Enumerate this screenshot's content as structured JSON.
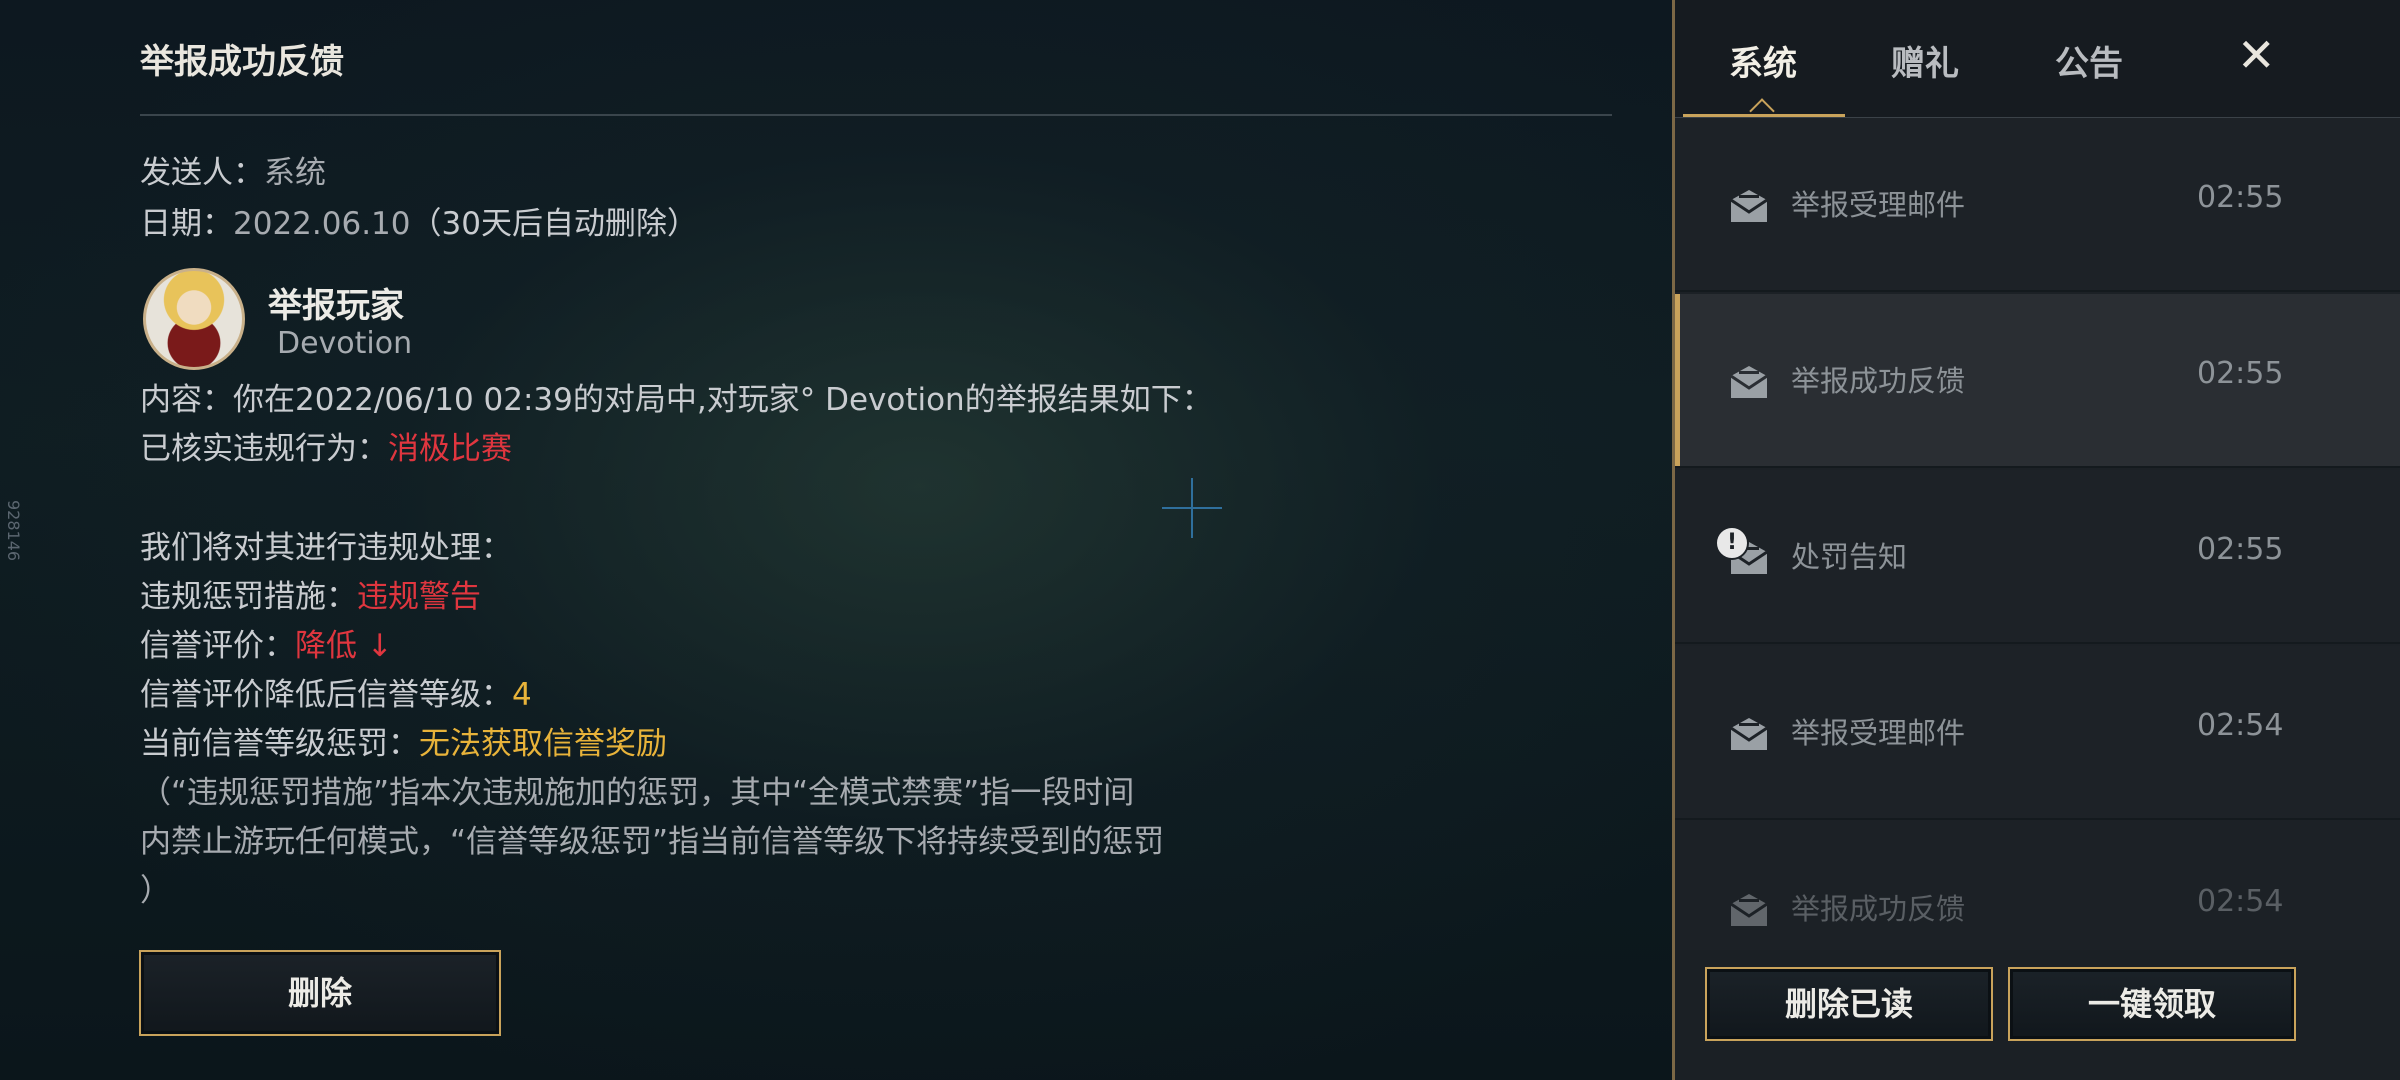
{
  "mail_detail": {
    "title": "举报成功反馈",
    "sender_label": "发送人：",
    "sender_value": "系统",
    "date_label": "日期：",
    "date_value": "2022.06.10",
    "auto_delete_note": "（30天后自动删除）",
    "reported_player_heading": "举报玩家",
    "reported_player_name": "Devotion",
    "content_line": "内容：你在2022/06/10 02:39的对局中,对玩家°  Devotion的举报结果如下：",
    "violation_label": "已核实违规行为：",
    "violation_value": "消极比赛",
    "handling_line": "我们将对其进行违规处理：",
    "penalty_label": "违规惩罚措施：",
    "penalty_value": "违规警告",
    "credit_label": "信誉评价：",
    "credit_value": "降低 ↓",
    "credit_level_label": "信誉评价降低后信誉等级：",
    "credit_level_value": "4",
    "current_penalty_label": "当前信誉等级惩罚：",
    "current_penalty_value": "无法获取信誉奖励",
    "note_line1": "（“违规惩罚措施”指本次违规施加的惩罚，其中“全模式禁赛”指一段时间",
    "note_line2": "内禁止游玩任何模式，“信誉等级惩罚”指当前信誉等级下将持续受到的惩罚",
    "note_line3": "）",
    "delete_button": "删除",
    "side_code": "928146"
  },
  "mailbox": {
    "tabs": [
      {
        "label": "系统",
        "active": true
      },
      {
        "label": "赠礼",
        "active": false
      },
      {
        "label": "公告",
        "active": false
      }
    ],
    "close_symbol": "✕",
    "items": [
      {
        "label": "举报受理邮件",
        "time": "02:55",
        "icon": "mail-read-icon"
      },
      {
        "label": "举报成功反馈",
        "time": "02:55",
        "icon": "mail-read-icon",
        "selected": true
      },
      {
        "label": "处罚告知",
        "time": "02:55",
        "icon": "mail-read-icon",
        "badge": "!"
      },
      {
        "label": "举报受理邮件",
        "time": "02:54",
        "icon": "mail-read-icon"
      },
      {
        "label": "举报成功反馈",
        "time": "02:54",
        "icon": "mail-read-icon"
      }
    ],
    "delete_read_button": "删除已读",
    "claim_all_button": "一键领取"
  },
  "colors": {
    "accent_gold": "#c9a35b",
    "warning_red": "#e0363f",
    "highlight_yellow": "#e8b33a"
  }
}
